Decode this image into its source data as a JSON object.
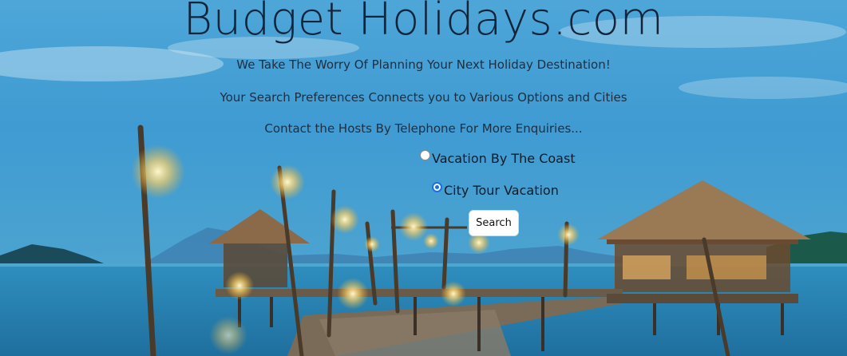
{
  "header": {
    "site_title": "Budget Holidays.com"
  },
  "intro": {
    "line1": "We Take The Worry Of Planning Your Next Holiday Destination!",
    "line2": "Your Search Preferences Connects you to Various Options and Cities",
    "line3": "Contact the Hosts By Telephone For More Enquiries..."
  },
  "options": [
    {
      "label": "Vacation By The Coast",
      "selected": false
    },
    {
      "label": "City Tour Vacation",
      "selected": true
    }
  ],
  "search": {
    "button_label": "Search"
  },
  "background": {
    "scene": "tropical pier at dusk"
  }
}
